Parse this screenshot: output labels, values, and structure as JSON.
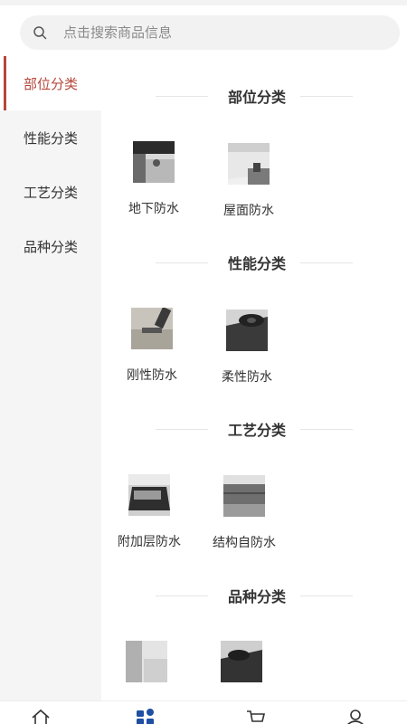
{
  "search": {
    "placeholder": "点击搜索商品信息"
  },
  "sidebar": {
    "items": [
      {
        "label": "部位分类"
      },
      {
        "label": "性能分类"
      },
      {
        "label": "工艺分类"
      },
      {
        "label": "品种分类"
      }
    ]
  },
  "sections": [
    {
      "title": "部位分类",
      "items": [
        {
          "label": "地下防水"
        },
        {
          "label": "屋面防水"
        }
      ]
    },
    {
      "title": "性能分类",
      "items": [
        {
          "label": "刚性防水"
        },
        {
          "label": "柔性防水"
        }
      ]
    },
    {
      "title": "工艺分类",
      "items": [
        {
          "label": "附加层防水"
        },
        {
          "label": "结构自防水"
        }
      ]
    },
    {
      "title": "品种分类",
      "items": [
        {
          "label": ""
        },
        {
          "label": ""
        }
      ]
    }
  ],
  "colors": {
    "accent": "#b5473a",
    "sidebar_bg": "#f5f5f5",
    "search_bg": "#f2f2f2"
  },
  "bottom_nav": {
    "icons": [
      "home-icon",
      "category-icon",
      "cart-icon",
      "user-icon"
    ],
    "active": "category-icon"
  }
}
